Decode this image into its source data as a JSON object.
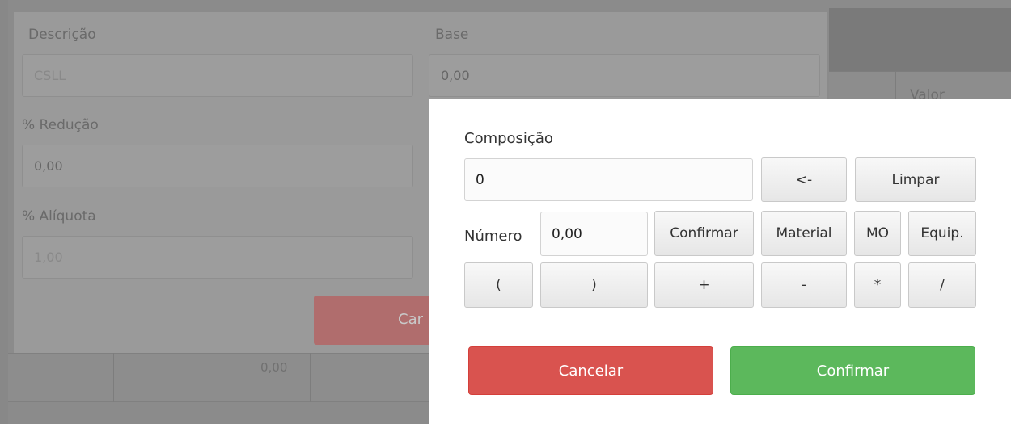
{
  "background": {
    "table_header_label": "Valor",
    "row_value": "0,00"
  },
  "tax_form": {
    "descricao_label": "Descrição",
    "descricao_value": "CSLL",
    "base_label": "Base",
    "base_value": "0,00",
    "reducao_label": "% Redução",
    "reducao_value": "0,00",
    "aliquota_label": "% Alíquota",
    "aliquota_value": "1,00",
    "cancel_label": "Car"
  },
  "composition": {
    "title": "Composição",
    "expression_value": "0",
    "backspace_label": "<-",
    "clear_label": "Limpar",
    "number_label": "Número",
    "number_value": "0,00",
    "confirm_number_label": "Confirmar",
    "material_label": "Material",
    "mo_label": "MO",
    "equip_label": "Equip.",
    "operators": [
      "(",
      ")",
      "+",
      "-",
      "*",
      "/"
    ],
    "cancel_label": "Cancelar",
    "confirm_label": "Confirmar"
  },
  "colors": {
    "danger": "#d9534f",
    "success": "#5cb85c",
    "overlay": "#888888"
  }
}
